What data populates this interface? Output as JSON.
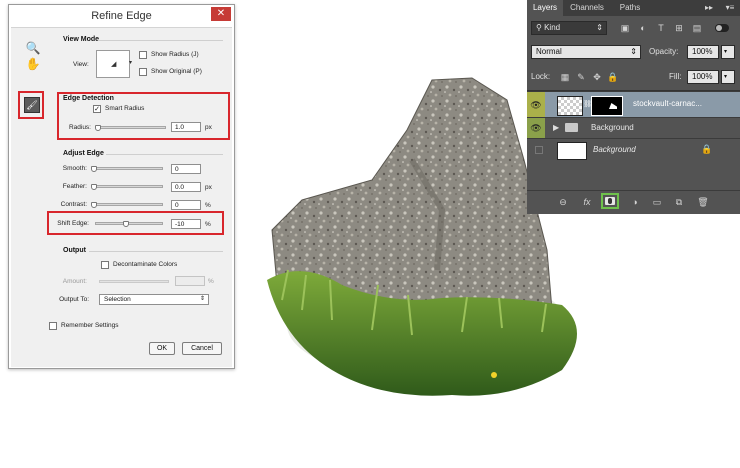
{
  "dialog": {
    "title": "Refine Edge",
    "close": "✕",
    "tools": {
      "zoom": "🔍",
      "hand": "✋",
      "brush": "🖌"
    },
    "view_mode": {
      "title": "View Mode",
      "view_label": "View:",
      "show_radius": "Show Radius (J)",
      "show_original": "Show Original (P)"
    },
    "edge_detection": {
      "title": "Edge Detection",
      "smart_radius": "Smart Radius",
      "smart_radius_checked": true,
      "radius_label": "Radius:",
      "radius_value": "1.0",
      "radius_unit": "px",
      "radius_fraction": 0.03
    },
    "adjust_edge": {
      "title": "Adjust Edge",
      "smooth_label": "Smooth:",
      "smooth_value": "0",
      "feather_label": "Feather:",
      "feather_value": "0.0",
      "feather_unit": "px",
      "contrast_label": "Contrast:",
      "contrast_value": "0",
      "contrast_unit": "%",
      "shift_label": "Shift Edge:",
      "shift_value": "-10",
      "shift_unit": "%",
      "shift_fraction": 0.45
    },
    "output": {
      "title": "Output",
      "decontaminate": "Decontaminate Colors",
      "amount_label": "Amount:",
      "amount_unit": "%",
      "output_to_label": "Output To:",
      "output_to_value": "Selection"
    },
    "remember": "Remember Settings",
    "ok": "OK",
    "cancel": "Cancel"
  },
  "layers_panel": {
    "tabs": [
      "Layers",
      "Channels",
      "Paths"
    ],
    "menu_icons": {
      "collapse": "▸▸",
      "menu": "▾≡"
    },
    "filter": {
      "kind": "Kind"
    },
    "blend_mode": "Normal",
    "opacity_label": "Opacity:",
    "opacity_value": "100%",
    "lock_label": "Lock:",
    "fill_label": "Fill:",
    "fill_value": "100%",
    "layers": [
      {
        "name": "stockvault-carnac...",
        "selected": true
      },
      {
        "name": "Background",
        "type": "group"
      },
      {
        "name": "Background",
        "locked": true
      }
    ],
    "bottom_icons": [
      "link",
      "fx",
      "mask",
      "adjustment",
      "folder",
      "new-layer",
      "trash"
    ],
    "fx_label": "fx",
    "colors": {
      "panel": "#535353",
      "selected_row": "#8a9aa8",
      "highlight": "#6ec14b"
    }
  }
}
